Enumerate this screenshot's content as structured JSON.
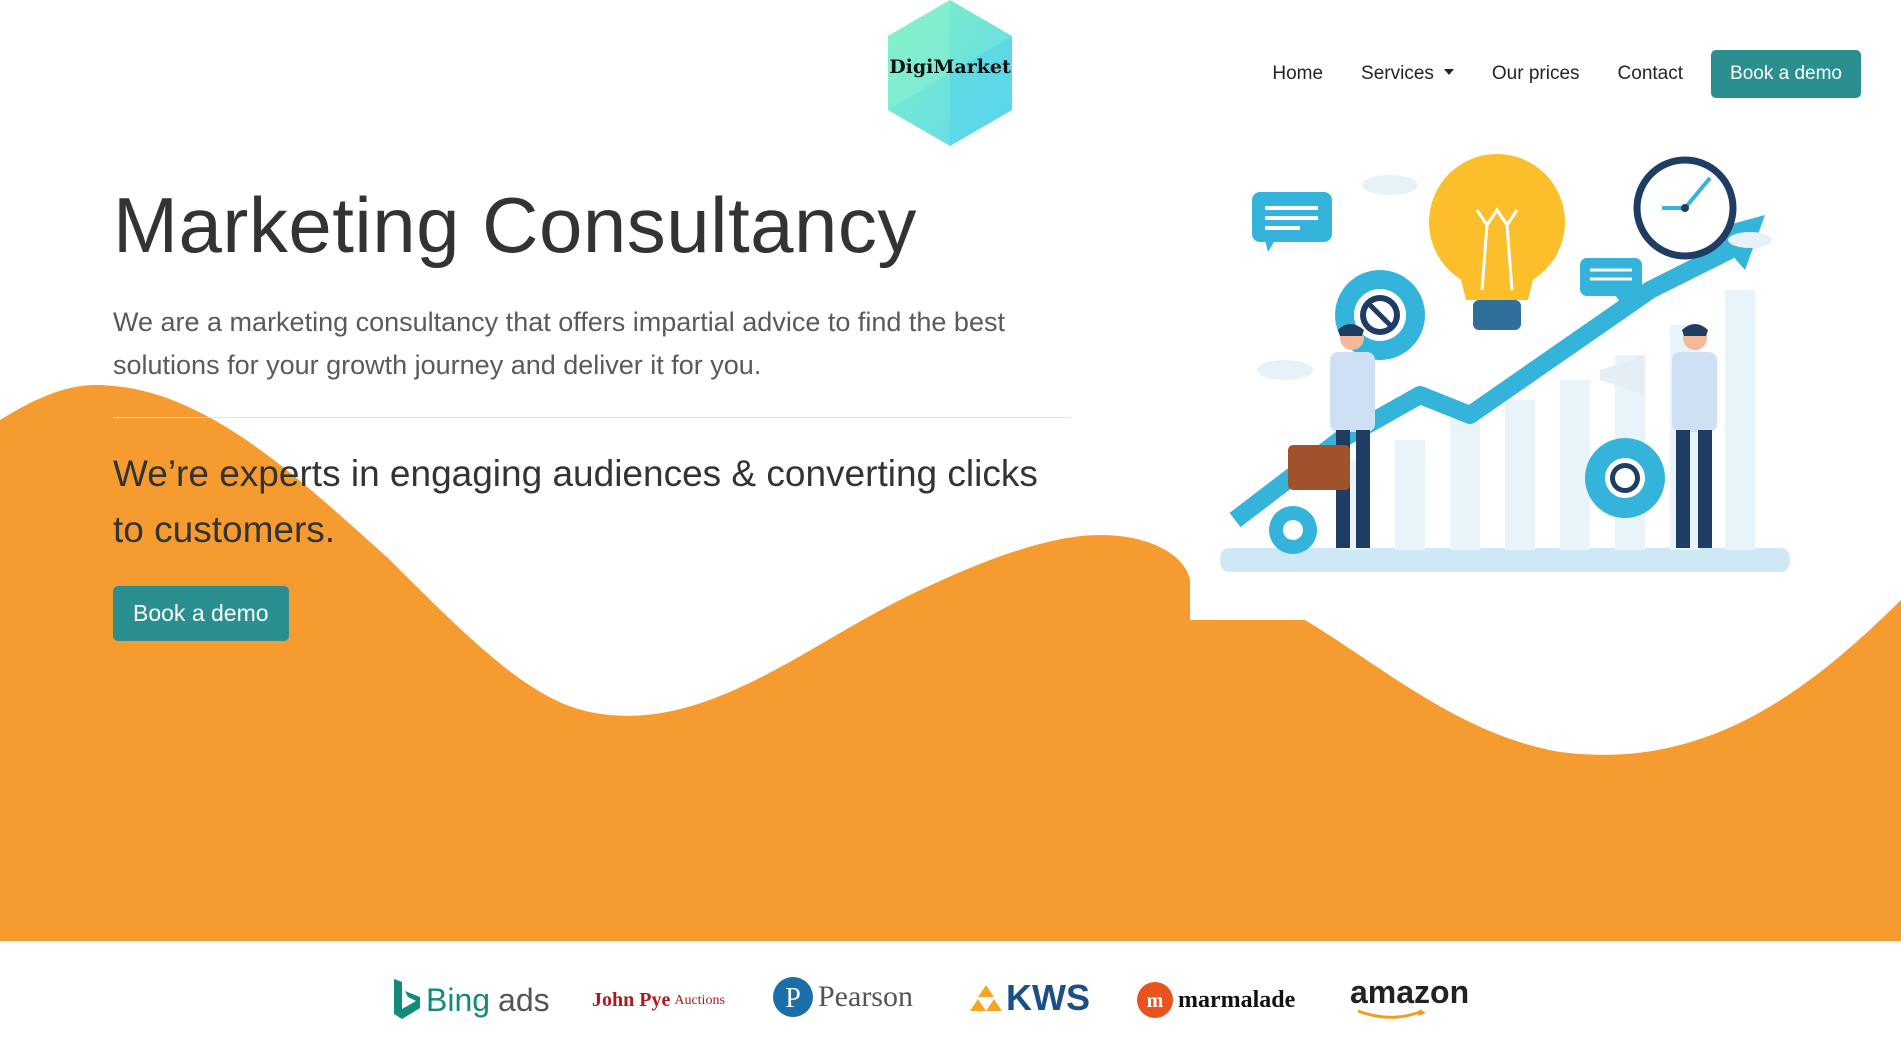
{
  "brand": {
    "logo_text": "DigiMarket",
    "colors": {
      "primary": "#2b8f8f",
      "accent": "#f59b30",
      "logo_gradient": [
        "#6ee7b7",
        "#67d9f0"
      ]
    }
  },
  "nav": {
    "links": [
      {
        "label": "Home",
        "icon": null
      },
      {
        "label": "Services",
        "icon": "caret-down-icon"
      },
      {
        "label": "Our prices",
        "icon": null
      },
      {
        "label": "Contact",
        "icon": null
      }
    ],
    "cta_label": "Book a demo"
  },
  "hero": {
    "title": "Marketing Consultancy",
    "description": "We are a marketing consultancy that offers impartial advice to find the best solutions for your growth journey and deliver it for you.",
    "subheading": "We’re experts in engaging audiences & converting clicks to customers.",
    "cta_label": "Book a demo",
    "illustration": "business-growth-illustration"
  },
  "partners": {
    "logos": [
      {
        "name": "bing-ads",
        "text_a": "Bing",
        "text_b": "ads"
      },
      {
        "name": "john-pye",
        "text_a": "John Pye",
        "text_b": "Auctions"
      },
      {
        "name": "pearson",
        "text_a": "Pearson",
        "text_b": ""
      },
      {
        "name": "kws",
        "text_a": "KWS",
        "text_b": ""
      },
      {
        "name": "marmalade",
        "text_a": "marmalade",
        "text_b": ""
      },
      {
        "name": "amazon",
        "text_a": "amazon",
        "text_b": ""
      }
    ]
  }
}
